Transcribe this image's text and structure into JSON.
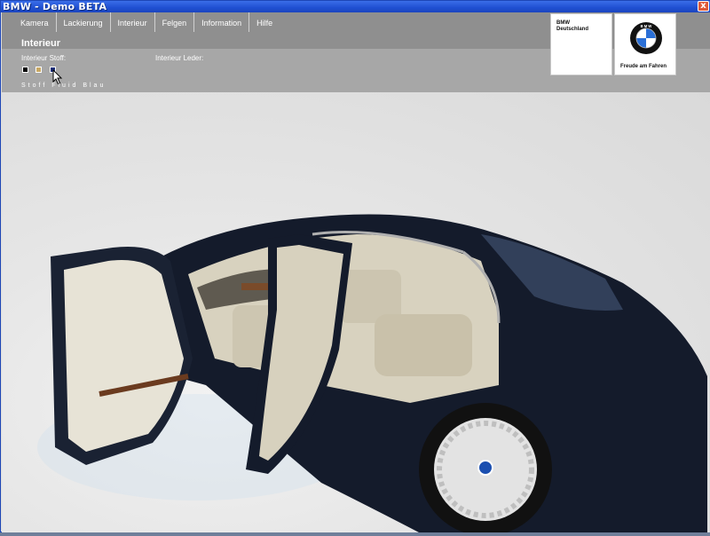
{
  "window": {
    "title": "BMW - Demo BETA",
    "close_label": "x"
  },
  "menu": {
    "items": [
      "Kamera",
      "Lackierung",
      "Interieur",
      "Felgen",
      "Information",
      "Hilfe"
    ]
  },
  "panel": {
    "title": "Interieur",
    "fabric_label": "Interieur Stoff:",
    "leather_label": "Interieur Leder:",
    "selected_name": "Stoff Fluid Blau"
  },
  "swatches": [
    {
      "name": "black",
      "color": "#000000"
    },
    {
      "name": "beige",
      "color": "#c8a864"
    },
    {
      "name": "blue",
      "color": "#1c2e78"
    }
  ],
  "brand": {
    "line1": "BMW",
    "line2": "Deutschland",
    "slogan": "Freude am Fahren",
    "logo_icon": "bmw-roundel-icon",
    "logo_letters": "B M W"
  },
  "scene": {
    "icon": "car-3d-render",
    "car_color": "#141b2b",
    "interior_color": "#d8d2bf"
  }
}
